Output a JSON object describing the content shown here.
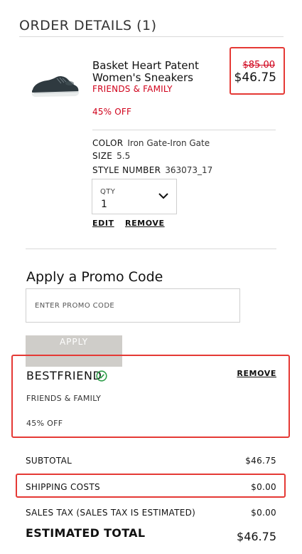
{
  "order": {
    "title": "ORDER DETAILS (1)"
  },
  "item": {
    "image_icon": "sneaker-image",
    "name": "Basket Heart Patent Women's Sneakers",
    "promo_tag": "FRIENDS & FAMILY",
    "discount_tag": "45% OFF",
    "original_price": "$85.00",
    "sale_price": "$46.75",
    "color_label": "COLOR",
    "color_value": "Iron Gate-Iron Gate",
    "size_label": "SIZE",
    "size_value": "5.5",
    "style_label": "STYLE NUMBER",
    "style_value": "363073_17",
    "qty_label": "QTY",
    "qty_value": "1",
    "edit_label": "EDIT",
    "remove_label": "REMOVE"
  },
  "promo": {
    "heading": "Apply a Promo Code",
    "placeholder": "ENTER PROMO CODE",
    "apply_label": "APPLY",
    "applied_code": "BESTFRIEND",
    "applied_type": "FRIENDS & FAMILY",
    "applied_discount": "45% OFF",
    "remove_label": "REMOVE"
  },
  "summary": {
    "subtotal_label": "SUBTOTAL",
    "subtotal_value": "$46.75",
    "shipping_label": "SHIPPING COSTS",
    "shipping_value": "$0.00",
    "tax_label": "SALES TAX (SALES TAX IS ESTIMATED)",
    "tax_value": "$0.00",
    "total_label": "ESTIMATED TOTAL",
    "total_value": "$46.75"
  },
  "colors": {
    "accent_red": "#d0021b",
    "highlight_border": "#e53935",
    "success_green": "#2e9e4a",
    "apply_disabled": "#cfcdc9"
  }
}
